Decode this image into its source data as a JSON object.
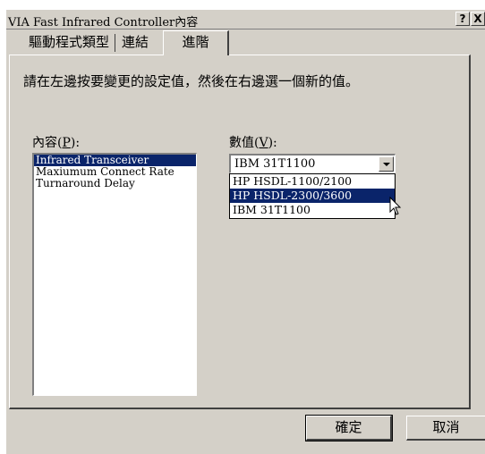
{
  "window": {
    "title": "VIA Fast Infrared Controller內容",
    "help_label": "?",
    "close_label": "X"
  },
  "tabs": [
    {
      "label": "驅動程式類型",
      "active": false
    },
    {
      "label": "連結",
      "active": false
    },
    {
      "label": "進階",
      "active": true
    }
  ],
  "advanced": {
    "instruction": "請在左邊按要變更的設定值，然後在右邊選一個新的值。",
    "property_label": "內容(P):",
    "property_label_main": "內容(",
    "property_label_key": "P",
    "property_label_end": "):",
    "value_label_main": "數值(",
    "value_label_key": "V",
    "value_label_end": "):",
    "properties": [
      {
        "label": "Infrared Transceiver",
        "selected": true
      },
      {
        "label": "Maxiumum Connect Rate",
        "selected": false
      },
      {
        "label": "Turnaround Delay",
        "selected": false
      }
    ],
    "value_selected": "IBM 31T1100",
    "value_options": [
      {
        "label": "HP HSDL-1100/2100",
        "highlighted": false
      },
      {
        "label": "HP HSDL-2300/3600",
        "highlighted": true
      },
      {
        "label": "IBM 31T1100",
        "highlighted": false
      }
    ]
  },
  "buttons": {
    "ok": "確定",
    "cancel": "取消"
  },
  "colors": {
    "face": "#d4d0c8",
    "selection": "#0a246a"
  }
}
